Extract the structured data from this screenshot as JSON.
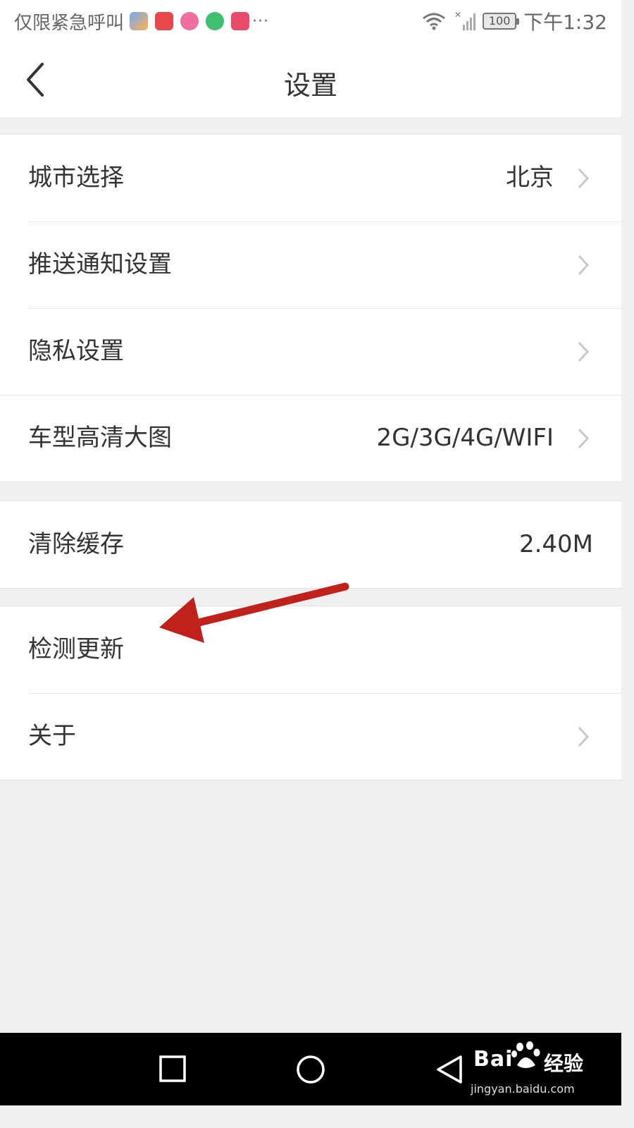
{
  "status_bar": {
    "carrier": "仅限紧急呼叫",
    "more": "···",
    "battery": "100",
    "time": "下午1:32"
  },
  "header": {
    "title": "设置"
  },
  "groups": [
    {
      "rows": [
        {
          "label": "城市选择",
          "value": "北京"
        },
        {
          "label": "推送通知设置"
        },
        {
          "label": "隐私设置"
        },
        {
          "label": "车型高清大图",
          "value": "2G/3G/4G/WIFI"
        }
      ]
    },
    {
      "rows": [
        {
          "label": "清除缓存",
          "value": "2.40M"
        }
      ]
    },
    {
      "rows": [
        {
          "label": "检测更新"
        },
        {
          "label": "关于"
        }
      ]
    }
  ],
  "watermark": {
    "brand": "Bai",
    "brand_cn": "经验",
    "url": "jingyan.baidu.com"
  },
  "colors": {
    "annotation_arrow": "#c0211b",
    "background": "#f0f0f0",
    "chevron": "#c8c8c8"
  }
}
